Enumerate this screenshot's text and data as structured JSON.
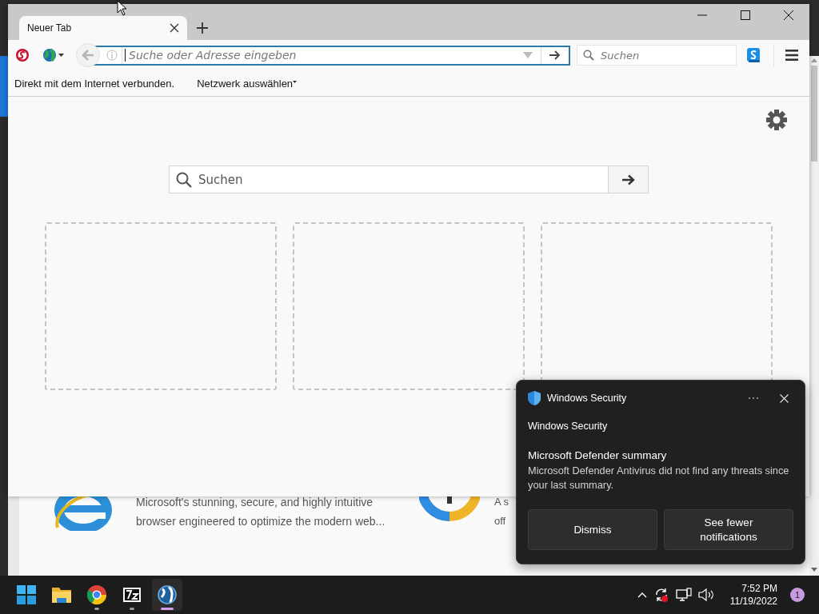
{
  "background_page": {
    "items": [
      {
        "kind": "ie",
        "lines": [
          "Microsoft's stunning, secure, and highly intuitive",
          "browser engineered to optimize the modern web..."
        ]
      },
      {
        "kind": "keyhole",
        "lines": [
          "A s",
          "off"
        ]
      }
    ]
  },
  "browser": {
    "tabs": [
      {
        "title": "Neuer Tab",
        "selected": true
      }
    ],
    "toolbar": {
      "back_disabled": true,
      "address": {
        "placeholder": "Suche oder Adresse eingeben",
        "focused": true
      },
      "search": {
        "placeholder": "Suchen"
      }
    },
    "proxy_bar": {
      "status": "Direkt mit dem Internet verbunden.",
      "network_menu": "Netzwerk auswählen"
    },
    "new_tab": {
      "search": {
        "placeholder": "Suchen"
      },
      "tiles": [
        {
          "kind": "empty"
        },
        {
          "kind": "empty"
        },
        {
          "kind": "empty"
        }
      ]
    }
  },
  "notification": {
    "app": "Windows Security",
    "attribution": "Windows Security",
    "title": "Microsoft Defender summary",
    "body": "Microsoft Defender Antivirus did not find any threats since your last summary.",
    "buttons": [
      "Dismiss",
      "See fewer notifications"
    ]
  },
  "taskbar": {
    "apps": [
      {
        "kind": "start",
        "running": false,
        "active": false
      },
      {
        "kind": "folder",
        "running": false,
        "active": false
      },
      {
        "kind": "chrome",
        "running": true,
        "active": false
      },
      {
        "kind": "archive",
        "running": true,
        "active": false
      },
      {
        "kind": "globe",
        "running": true,
        "active": true
      }
    ],
    "clock": {
      "time": "7:52 PM",
      "date": "11/19/2022"
    },
    "notification_count": "1"
  }
}
